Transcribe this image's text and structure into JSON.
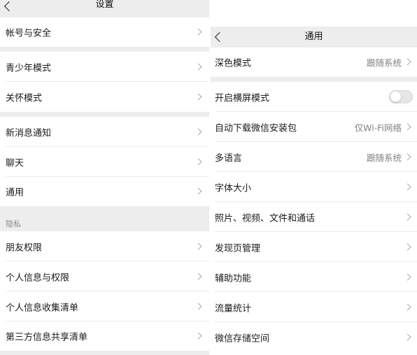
{
  "settings": {
    "title": "设置",
    "items": [
      {
        "label": "帐号与安全"
      },
      {
        "label": "青少年模式"
      },
      {
        "label": "关怀模式"
      },
      {
        "label": "新消息通知"
      },
      {
        "label": "聊天"
      },
      {
        "label": "通用"
      },
      {
        "label": "朋友权限"
      },
      {
        "label": "个人信息与权限"
      },
      {
        "label": "个人信息收集清单"
      },
      {
        "label": "第三方信息共享清单"
      }
    ],
    "privacy_header": "隐私"
  },
  "general": {
    "title": "通用",
    "items": [
      {
        "label": "深色模式",
        "value": "跟随系统"
      },
      {
        "label": "开启横屏模式",
        "toggle": false
      },
      {
        "label": "自动下载微信安装包",
        "value": "仅Wi-Fi网络"
      },
      {
        "label": "多语言",
        "value": "跟随系统"
      },
      {
        "label": "字体大小"
      },
      {
        "label": "照片、视频、文件和通话"
      },
      {
        "label": "发现页管理"
      },
      {
        "label": "辅助功能"
      },
      {
        "label": "流量统计"
      },
      {
        "label": "微信存储空间"
      }
    ]
  },
  "icons": {
    "back": "chevron-left-icon",
    "row_arrow": "chevron-right-icon"
  },
  "colors": {
    "page_bg": "#ededed",
    "row_bg": "#ffffff",
    "secondary_text": "#808080",
    "toggle_off": "#e6e6e6"
  }
}
